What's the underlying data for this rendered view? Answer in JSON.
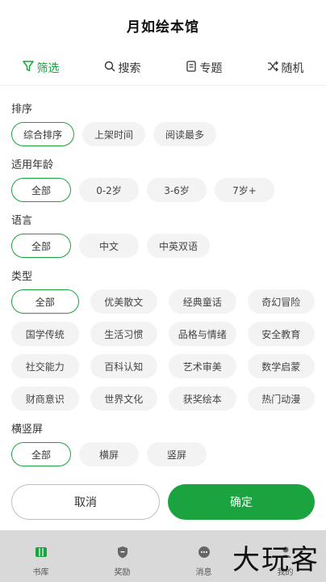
{
  "header": {
    "title": "月如绘本馆"
  },
  "tabs": [
    {
      "label": "筛选",
      "icon": "filter-icon"
    },
    {
      "label": "搜索",
      "icon": "search-icon"
    },
    {
      "label": "专题",
      "icon": "book-icon"
    },
    {
      "label": "随机",
      "icon": "shuffle-icon"
    }
  ],
  "filters": {
    "sort": {
      "label": "排序",
      "options": [
        "综合排序",
        "上架时间",
        "阅读最多"
      ],
      "selected": "综合排序"
    },
    "age": {
      "label": "适用年龄",
      "options": [
        "全部",
        "0-2岁",
        "3-6岁",
        "7岁+"
      ],
      "selected": "全部"
    },
    "language": {
      "label": "语言",
      "options": [
        "全部",
        "中文",
        "中英双语"
      ],
      "selected": "全部"
    },
    "type": {
      "label": "类型",
      "options": [
        "全部",
        "优美散文",
        "经典童话",
        "奇幻冒险",
        "国学传统",
        "生活习惯",
        "品格与情绪",
        "安全教育",
        "社交能力",
        "百科认知",
        "艺术审美",
        "数学启蒙",
        "财商意识",
        "世界文化",
        "获奖绘本",
        "热门动漫"
      ],
      "selected": "全部"
    },
    "orientation": {
      "label": "横竖屏",
      "options": [
        "全部",
        "横屏",
        "竖屏"
      ],
      "selected": "全部"
    }
  },
  "actions": {
    "cancel_label": "取消",
    "confirm_label": "确定"
  },
  "bottom_nav": [
    {
      "label": "书库",
      "icon": "library-icon"
    },
    {
      "label": "奖励",
      "icon": "shield-icon"
    },
    {
      "label": "消息",
      "icon": "message-icon"
    },
    {
      "label": "我的",
      "icon": "user-icon"
    }
  ],
  "watermark": "大玩客",
  "colors": {
    "accent": "#1aa33f",
    "chip_bg": "#f3f3f3"
  }
}
